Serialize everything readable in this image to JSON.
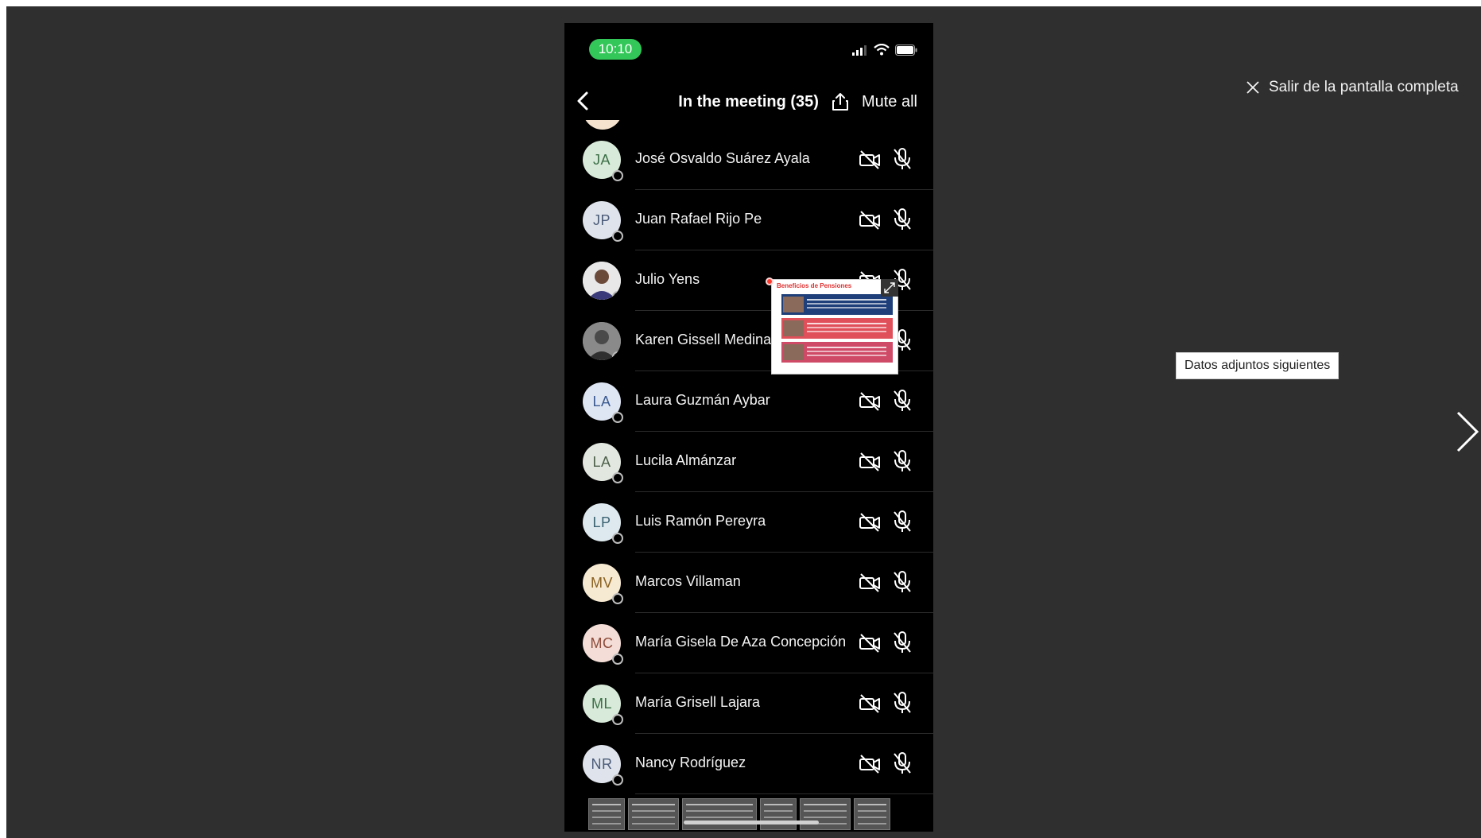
{
  "viewer": {
    "exit_fullscreen_label": "Salir de la pantalla completa",
    "next_tooltip": "Datos adjuntos siguientes",
    "background_color": "#2f2f2f"
  },
  "phone": {
    "status_time": "10:10",
    "nav_title": "In the meeting (35)",
    "mute_all_label": "Mute all",
    "participants": [
      {
        "initials": "JA",
        "name": "José Osvaldo Suárez Ayala",
        "avatar_bg": "#d8ead9",
        "avatar_fg": "#3c6f47",
        "photo": false
      },
      {
        "initials": "JP",
        "name": "Juan Rafael Rijo Pе",
        "avatar_bg": "#dfe4ec",
        "avatar_fg": "#4a5a78",
        "photo": false
      },
      {
        "initials": "",
        "name": "Julio Yens",
        "avatar_bg": "#f0f0f0",
        "avatar_fg": "#333333",
        "photo": true
      },
      {
        "initials": "",
        "name": "Karen Gissell Medina",
        "avatar_bg": "#9a9a9a",
        "avatar_fg": "#333333",
        "photo": true
      },
      {
        "initials": "LA",
        "name": "Laura Guzmán Aybar",
        "avatar_bg": "#dfe6f3",
        "avatar_fg": "#3b5a90",
        "photo": false
      },
      {
        "initials": "LA",
        "name": "Lucila Almánzar",
        "avatar_bg": "#e2e8e0",
        "avatar_fg": "#4d5f4a",
        "photo": false
      },
      {
        "initials": "LP",
        "name": "Luis Ramón Pereyra",
        "avatar_bg": "#dde9ee",
        "avatar_fg": "#3c6272",
        "photo": false
      },
      {
        "initials": "MV",
        "name": "Marcos Villaman",
        "avatar_bg": "#f7ead2",
        "avatar_fg": "#8a6120",
        "photo": false
      },
      {
        "initials": "MC",
        "name": "María Gisela De Aza Concepción",
        "avatar_bg": "#f3ddd6",
        "avatar_fg": "#8e4b3a",
        "photo": false
      },
      {
        "initials": "ML",
        "name": "María Grisell Lajara",
        "avatar_bg": "#d8ead9",
        "avatar_fg": "#3c6f47",
        "photo": false
      },
      {
        "initials": "NR",
        "name": "Nancy Rodríguez",
        "avatar_bg": "#dfe4ec",
        "avatar_fg": "#4a5a78",
        "photo": false
      }
    ],
    "shared_content": {
      "slide_title": "Beneficios de Pensiones"
    }
  },
  "icons": {
    "camera_off": "camera-off-icon",
    "mic_off": "mic-off-icon",
    "back": "chevron-left-icon",
    "share": "share-icon",
    "close": "close-icon",
    "next": "chevron-right-icon"
  }
}
